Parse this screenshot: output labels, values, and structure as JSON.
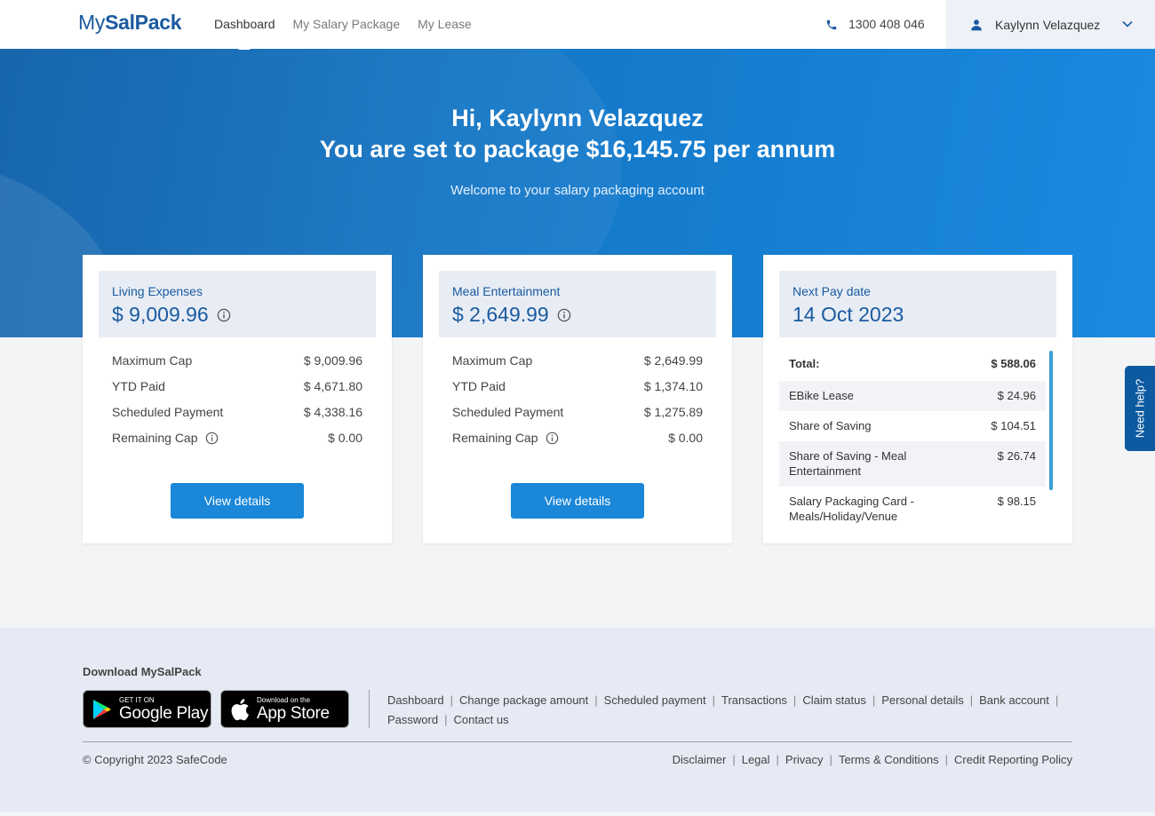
{
  "header": {
    "logo_prefix": "My",
    "logo_bold": "SalPack",
    "nav": [
      {
        "label": "Dashboard",
        "active": true
      },
      {
        "label": "My Salary Package",
        "active": false
      },
      {
        "label": "My Lease",
        "active": false
      }
    ],
    "phone": "1300 408 046",
    "user_name": "Kaylynn Velazquez"
  },
  "hero": {
    "greeting": "Hi, Kaylynn Velazquez",
    "package_line": "You are set to package $16,145.75 per annum",
    "welcome": "Welcome to your salary packaging account"
  },
  "cards": [
    {
      "title": "Living Expenses",
      "amount": "$ 9,009.96",
      "rows": [
        {
          "label": "Maximum Cap",
          "value": "$ 9,009.96"
        },
        {
          "label": "YTD Paid",
          "value": "$ 4,671.80"
        },
        {
          "label": "Scheduled Payment",
          "value": "$ 4,338.16"
        },
        {
          "label": "Remaining Cap",
          "value": "$ 0.00"
        }
      ],
      "button": "View details"
    },
    {
      "title": "Meal Entertainment",
      "amount": "$ 2,649.99",
      "rows": [
        {
          "label": "Maximum Cap",
          "value": "$ 2,649.99"
        },
        {
          "label": "YTD Paid",
          "value": "$ 1,374.10"
        },
        {
          "label": "Scheduled Payment",
          "value": "$ 1,275.89"
        },
        {
          "label": "Remaining Cap",
          "value": "$ 0.00"
        }
      ],
      "button": "View details"
    }
  ],
  "pay": {
    "title": "Next Pay date",
    "date": "14 Oct 2023",
    "total_label": "Total:",
    "total_value": "$ 588.06",
    "items": [
      {
        "label": "EBike Lease",
        "value": "$ 24.96"
      },
      {
        "label": "Share of Saving",
        "value": "$ 104.51"
      },
      {
        "label": "Share of Saving - Meal Entertainment",
        "value": "$ 26.74"
      },
      {
        "label": "Salary Packaging Card - Meals/Holiday/Venue",
        "value": "$ 98.15"
      }
    ]
  },
  "need_help": "Need help?",
  "footer": {
    "download_title": "Download MySalPack",
    "google_small": "GET IT ON",
    "google_big": "Google Play",
    "apple_small": "Download on the",
    "apple_big": "App Store",
    "links": [
      "Dashboard",
      "Change package amount",
      "Scheduled payment",
      "Transactions",
      "Claim status",
      "Personal details",
      "Bank account",
      "Password",
      "Contact us"
    ],
    "copyright": "© Copyright 2023 SafeCode",
    "legal": [
      "Disclaimer",
      "Legal",
      "Privacy",
      "Terms & Conditions",
      "Credit Reporting Policy"
    ]
  },
  "colors": {
    "brand": "#1a5aa0",
    "button": "#1a87d8",
    "hero_start": "#0b5ea8",
    "hero_end": "#1b8ae0"
  }
}
